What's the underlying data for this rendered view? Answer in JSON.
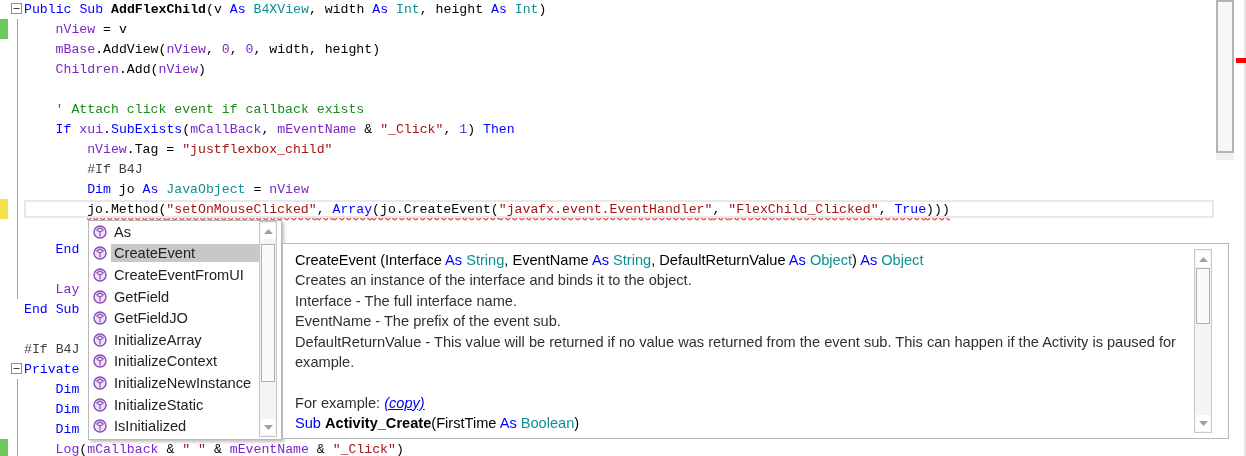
{
  "editor": {
    "lines": [
      {
        "kind": "code",
        "expanded": true,
        "segments": [
          {
            "kind": "kw",
            "t": "Public Sub "
          },
          {
            "kind": "fn",
            "t": "AddFlexChild"
          },
          {
            "kind": "p",
            "t": "(v "
          },
          {
            "kind": "kw",
            "t": "As "
          },
          {
            "kind": "type",
            "t": "B4XView"
          },
          {
            "kind": "p",
            "t": ", width "
          },
          {
            "kind": "kw",
            "t": "As "
          },
          {
            "kind": "type",
            "t": "Int"
          },
          {
            "kind": "p",
            "t": ", height "
          },
          {
            "kind": "kw",
            "t": "As "
          },
          {
            "kind": "type",
            "t": "Int"
          },
          {
            "kind": "p",
            "t": ")"
          }
        ],
        "children": [
          {
            "kind": "code",
            "changed": true,
            "saved": true,
            "segments": [
              {
                "kind": "var",
                "t": "nView"
              },
              {
                "kind": "p",
                "t": " = v"
              }
            ]
          },
          {
            "kind": "code",
            "segments": [
              {
                "kind": "var",
                "t": "mBase"
              },
              {
                "kind": "p",
                "t": ".AddView("
              },
              {
                "kind": "var",
                "t": "nView"
              },
              {
                "kind": "p",
                "t": ", "
              },
              {
                "kind": "num",
                "t": "0"
              },
              {
                "kind": "p",
                "t": ", "
              },
              {
                "kind": "num",
                "t": "0"
              },
              {
                "kind": "p",
                "t": ", width, height)"
              }
            ]
          },
          {
            "kind": "code",
            "segments": [
              {
                "kind": "var",
                "t": "Children"
              },
              {
                "kind": "p",
                "t": ".Add("
              },
              {
                "kind": "var",
                "t": "nView"
              },
              {
                "kind": "p",
                "t": ")"
              }
            ]
          },
          {
            "kind": "blank"
          },
          {
            "kind": "code",
            "segments": [
              {
                "kind": "com",
                "t": "' Attach click event if callback exists"
              }
            ]
          },
          {
            "kind": "code",
            "segments": [
              {
                "kind": "kw",
                "t": "If "
              },
              {
                "kind": "var",
                "t": "xui"
              },
              {
                "kind": "p",
                "t": "."
              },
              {
                "kind": "kw",
                "t": "SubExists"
              },
              {
                "kind": "p",
                "t": "("
              },
              {
                "kind": "var",
                "t": "mCallBack"
              },
              {
                "kind": "p",
                "t": ", "
              },
              {
                "kind": "var",
                "t": "mEventName"
              },
              {
                "kind": "p",
                "t": " & "
              },
              {
                "kind": "str",
                "t": "\"_Click\""
              },
              {
                "kind": "p",
                "t": ", "
              },
              {
                "kind": "num",
                "t": "1"
              },
              {
                "kind": "p",
                "t": ") "
              },
              {
                "kind": "kw",
                "t": "Then"
              }
            ],
            "children": [
              {
                "kind": "code",
                "segments": [
                  {
                    "kind": "var",
                    "t": "nView"
                  },
                  {
                    "kind": "p",
                    "t": ".Tag = "
                  },
                  {
                    "kind": "str",
                    "t": "\"justflexbox_child\""
                  }
                ]
              },
              {
                "kind": "code",
                "segments": [
                  {
                    "kind": "dir",
                    "t": "#If B4J"
                  }
                ]
              },
              {
                "kind": "code",
                "segments": [
                  {
                    "kind": "kw",
                    "t": "Dim "
                  },
                  {
                    "kind": "p",
                    "t": "jo "
                  },
                  {
                    "kind": "kw",
                    "t": "As "
                  },
                  {
                    "kind": "type",
                    "t": "JavaObject"
                  },
                  {
                    "kind": "p",
                    "t": " = "
                  },
                  {
                    "kind": "var",
                    "t": "nView"
                  }
                ]
              },
              {
                "kind": "code",
                "changed": true,
                "saved": false,
                "current": true,
                "error": true,
                "segments": [
                  {
                    "kind": "p",
                    "t": "jo.Method("
                  },
                  {
                    "kind": "str",
                    "t": "\"setOnMouseClicked\""
                  },
                  {
                    "kind": "p",
                    "t": ", "
                  },
                  {
                    "kind": "kw",
                    "t": "Array"
                  },
                  {
                    "kind": "p",
                    "t": "(jo.CreateEvent("
                  },
                  {
                    "kind": "str",
                    "t": "\"javafx.event.EventHandler\""
                  },
                  {
                    "kind": "p",
                    "t": ", "
                  },
                  {
                    "kind": "str",
                    "t": "\"FlexChild_Clicked\""
                  },
                  {
                    "kind": "p",
                    "t": ", "
                  },
                  {
                    "kind": "kw",
                    "t": "True"
                  },
                  {
                    "kind": "p",
                    "t": ")))"
                  }
                ]
              },
              {
                "kind": "blank"
              }
            ]
          },
          {
            "kind": "code",
            "segments": [
              {
                "kind": "kw",
                "t": "End"
              }
            ]
          },
          {
            "kind": "blank"
          },
          {
            "kind": "code",
            "segments": [
              {
                "kind": "var",
                "t": "Lay"
              }
            ]
          }
        ]
      },
      {
        "kind": "code",
        "segments": [
          {
            "kind": "kw",
            "t": "End Sub"
          }
        ]
      },
      {
        "kind": "blank"
      },
      {
        "kind": "code",
        "segments": [
          {
            "kind": "dir",
            "t": "#If B4J"
          }
        ]
      },
      {
        "kind": "code",
        "expanded": true,
        "segments": [
          {
            "kind": "kw",
            "t": "Private"
          }
        ],
        "children": [
          {
            "kind": "code",
            "segments": [
              {
                "kind": "kw",
                "t": "Dim"
              }
            ]
          },
          {
            "kind": "code",
            "segments": [
              {
                "kind": "kw",
                "t": "Dim"
              }
            ]
          },
          {
            "kind": "code",
            "segments": [
              {
                "kind": "kw",
                "t": "Dim"
              }
            ]
          },
          {
            "kind": "code",
            "changed": true,
            "saved": true,
            "segments": [
              {
                "kind": "var",
                "t": "Log"
              },
              {
                "kind": "p",
                "t": "("
              },
              {
                "kind": "var",
                "t": "mCallback"
              },
              {
                "kind": "p",
                "t": " & "
              },
              {
                "kind": "str",
                "t": "\" \""
              },
              {
                "kind": "p",
                "t": " & "
              },
              {
                "kind": "var",
                "t": "mEventName"
              },
              {
                "kind": "p",
                "t": " & "
              },
              {
                "kind": "str",
                "t": "\"_Click\""
              },
              {
                "kind": "p",
                "t": ")"
              }
            ]
          }
        ]
      }
    ]
  },
  "completion": {
    "items": [
      {
        "label": "As",
        "selected": false
      },
      {
        "label": "CreateEvent",
        "selected": true
      },
      {
        "label": "CreateEventFromUI",
        "selected": false
      },
      {
        "label": "GetField",
        "selected": false
      },
      {
        "label": "GetFieldJO",
        "selected": false
      },
      {
        "label": "InitializeArray",
        "selected": false
      },
      {
        "label": "InitializeContext",
        "selected": false
      },
      {
        "label": "InitializeNewInstance",
        "selected": false
      },
      {
        "label": "InitializeStatic",
        "selected": false
      },
      {
        "label": "IsInitialized",
        "selected": false
      }
    ]
  },
  "tooltip": {
    "signature": [
      {
        "kind": "p",
        "t": "CreateEvent (Interface "
      },
      {
        "kind": "kw",
        "t": "As "
      },
      {
        "kind": "type",
        "t": "String"
      },
      {
        "kind": "p",
        "t": ", EventName "
      },
      {
        "kind": "kw",
        "t": "As "
      },
      {
        "kind": "type",
        "t": "String"
      },
      {
        "kind": "p",
        "t": ", DefaultReturnValue "
      },
      {
        "kind": "kw",
        "t": "As "
      },
      {
        "kind": "type",
        "t": "Object"
      },
      {
        "kind": "p",
        "t": ") "
      },
      {
        "kind": "kw",
        "t": "As "
      },
      {
        "kind": "type",
        "t": "Object"
      }
    ],
    "description": [
      "Creates an instance of the interface and binds it to the object.",
      "Interface - The full interface name.",
      "EventName - The prefix of the event sub.",
      "DefaultReturnValue - This value will be returned if no value was returned from the event sub. This can happen if the Activity is paused for example."
    ],
    "example_label": "For example:",
    "copy_link": "(copy)",
    "example_code": [
      [
        {
          "kind": "kw",
          "t": "Sub "
        },
        {
          "kind": "fn",
          "t": "Activity_Create"
        },
        {
          "kind": "p",
          "t": "(FirstTime "
        },
        {
          "kind": "kw",
          "t": "As "
        },
        {
          "kind": "type",
          "t": "Boolean"
        },
        {
          "kind": "p",
          "t": ")"
        }
      ]
    ]
  }
}
